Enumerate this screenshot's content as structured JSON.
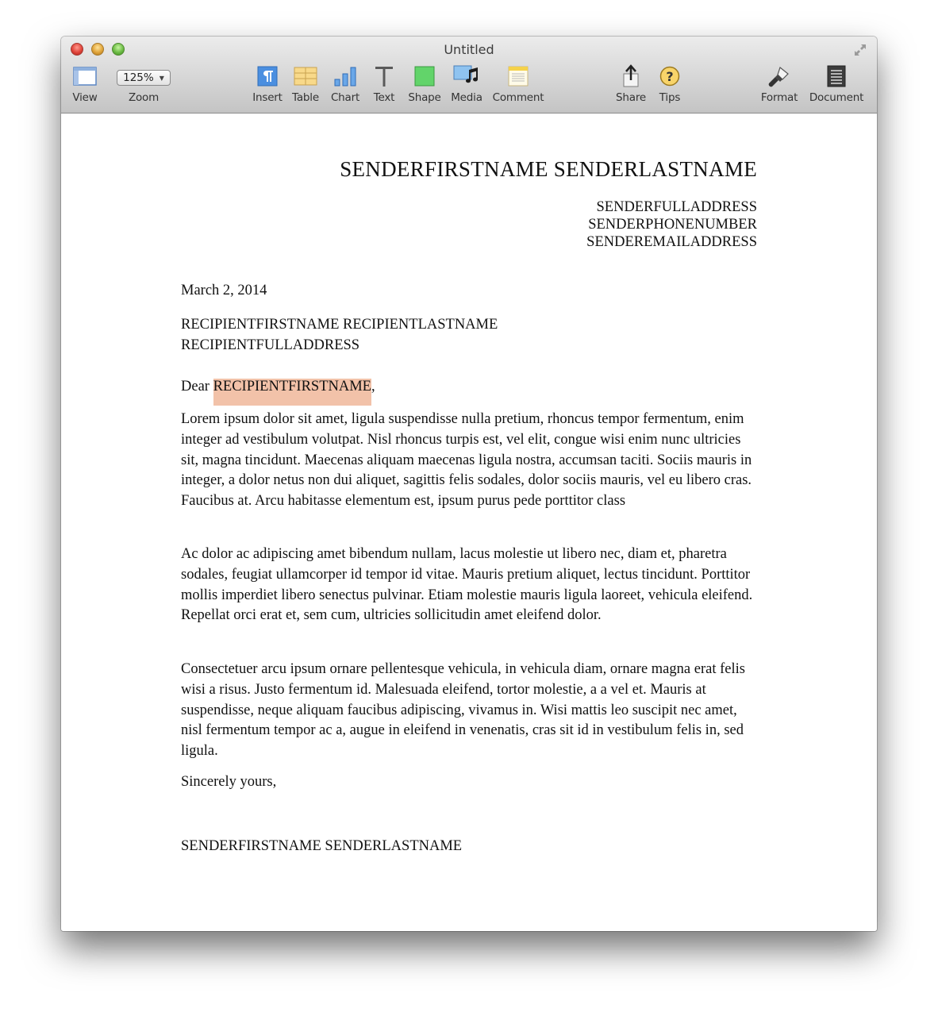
{
  "window": {
    "title": "Untitled"
  },
  "toolbar": {
    "left": [
      {
        "id": "view",
        "label": "View",
        "icon": "view-sidebar-icon"
      },
      {
        "id": "zoom",
        "label": "Zoom",
        "value": "125%",
        "icon": "chevron-down-icon"
      }
    ],
    "center": [
      {
        "id": "insert",
        "label": "Insert",
        "icon": "paragraph-icon"
      },
      {
        "id": "table",
        "label": "Table",
        "icon": "table-icon"
      },
      {
        "id": "chart",
        "label": "Chart",
        "icon": "bar-chart-icon"
      },
      {
        "id": "text",
        "label": "Text",
        "icon": "text-icon"
      },
      {
        "id": "shape",
        "label": "Shape",
        "icon": "shape-icon"
      },
      {
        "id": "media",
        "label": "Media",
        "icon": "media-icon"
      },
      {
        "id": "comment",
        "label": "Comment",
        "icon": "comment-icon"
      }
    ],
    "right": [
      {
        "id": "share",
        "label": "Share",
        "icon": "share-icon"
      },
      {
        "id": "tips",
        "label": "Tips",
        "icon": "question-icon"
      },
      {
        "id": "format",
        "label": "Format",
        "icon": "paintbrush-icon"
      },
      {
        "id": "document",
        "label": "Document",
        "icon": "document-icon"
      }
    ]
  },
  "colors": {
    "highlight": "#f2c2a9"
  },
  "letter": {
    "sender_name": "SENDERFIRSTNAME SENDERLASTNAME",
    "sender_address": "SENDERFULLADDRESS",
    "sender_phone": "SENDERPHONENUMBER",
    "sender_email": "SENDEREMAILADDRESS",
    "date": "March 2, 2014",
    "recipient_name": "RECIPIENTFIRSTNAME RECIPIENTLASTNAME",
    "recipient_address": "RECIPIENTFULLADDRESS",
    "greeting_prefix": "Dear ",
    "greeting_name": "RECIPIENTFIRSTNAME",
    "greeting_suffix": ",",
    "paragraphs": [
      "Lorem ipsum dolor sit amet, ligula suspendisse nulla pretium, rhoncus tempor fermentum, enim integer ad vestibulum volutpat. Nisl rhoncus turpis est, vel elit, congue wisi enim nunc ultricies sit, magna tincidunt. Maecenas aliquam maecenas ligula nostra, accumsan taciti. Sociis mauris in integer, a dolor netus non dui aliquet, sagittis felis sodales, dolor sociis mauris, vel eu libero cras. Faucibus at. Arcu habitasse elementum est, ipsum purus pede porttitor class",
      "Ac dolor ac adipiscing amet bibendum nullam, lacus molestie ut libero nec, diam et, pharetra sodales, feugiat ullamcorper id tempor id vitae. Mauris pretium aliquet, lectus tincidunt. Porttitor mollis imperdiet libero senectus pulvinar. Etiam molestie mauris ligula laoreet, vehicula eleifend. Repellat orci erat et, sem cum, ultricies sollicitudin amet eleifend dolor.",
      "Consectetuer arcu ipsum ornare pellentesque vehicula, in vehicula diam, ornare magna erat felis wisi a risus. Justo fermentum id. Malesuada eleifend, tortor molestie, a a vel et. Mauris at suspendisse, neque aliquam faucibus adipiscing, vivamus in. Wisi mattis leo suscipit nec amet, nisl fermentum tempor ac a, augue in eleifend in venenatis, cras sit id in vestibulum felis in, sed ligula."
    ],
    "closing": "Sincerely yours,",
    "signature": "SENDERFIRSTNAME SENDERLASTNAME"
  }
}
